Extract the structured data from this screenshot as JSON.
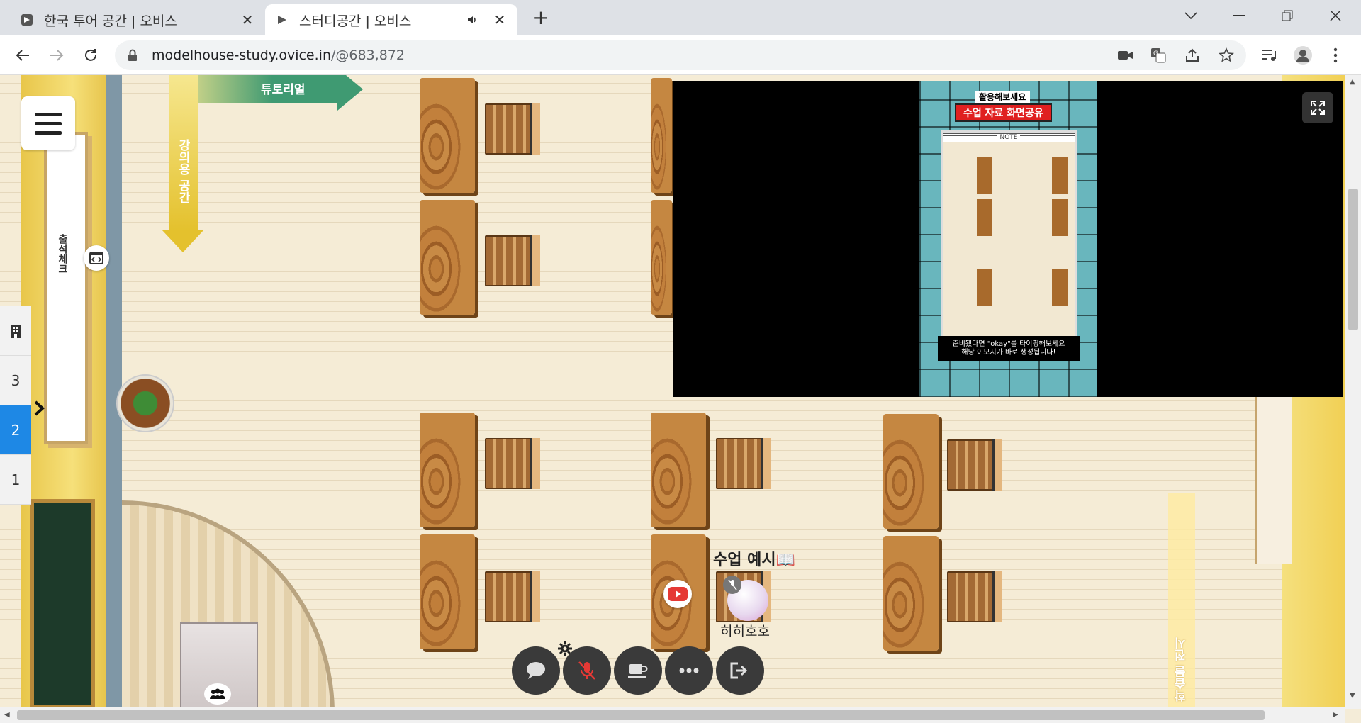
{
  "browser": {
    "tabs": [
      {
        "title": "한국 투어 공간 | 오비스",
        "active": false
      },
      {
        "title": "스터디공간 | 오비스",
        "active": true,
        "audio": true
      }
    ],
    "new_tab_symbol": "+",
    "url_domain": "modelhouse-study.ovice.in",
    "url_path": "/@683,872",
    "window_controls": [
      "chevron-down-icon",
      "minimize-icon",
      "restore-icon",
      "close-icon"
    ]
  },
  "space": {
    "floors": [
      "3",
      "2",
      "1"
    ],
    "selected_floor": "2",
    "labels": {
      "tutorial": "튜토리얼",
      "lecture_space": "강의용 공간",
      "attendance": "출석체크",
      "study_exhibit": "학습물 전시",
      "class_example": "수업 예시📖"
    },
    "user": {
      "name": "히히호호",
      "mic_muted": true
    }
  },
  "screen_share": {
    "subtitle": "활용해보세요",
    "heading": "수업 자료 화면공유",
    "note_label": "NOTE",
    "caption_line1": "준비됐다면 \"okay\"를 타이핑해보세요",
    "caption_line2": "해당 이모지가 바로 생성됩니다!"
  },
  "dock": [
    "chat-icon",
    "mic-muted-icon",
    "coffee-icon",
    "more-icon",
    "exit-icon"
  ],
  "colors": {
    "accent": "#1e88e5",
    "dock": "#3a3a3a",
    "muted_red": "#e53935"
  }
}
